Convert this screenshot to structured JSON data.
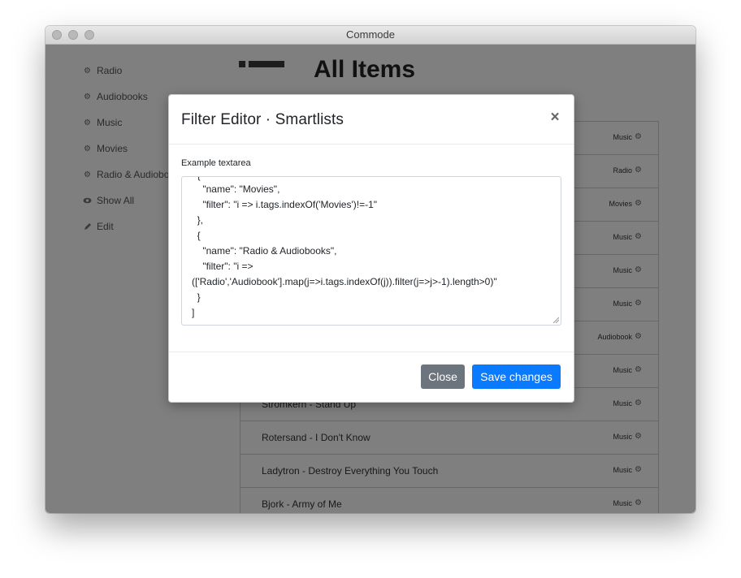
{
  "window": {
    "title": "Commode"
  },
  "sidebar": {
    "items": [
      {
        "label": "Radio",
        "icon": "gear-icon"
      },
      {
        "label": "Audiobooks",
        "icon": "gear-icon"
      },
      {
        "label": "Music",
        "icon": "gear-icon"
      },
      {
        "label": "Movies",
        "icon": "gear-icon"
      },
      {
        "label": "Radio & Audiobo",
        "icon": "gear-icon"
      },
      {
        "label": "Show All",
        "icon": "eye-icon"
      },
      {
        "label": "Edit",
        "icon": "pencil-icon"
      }
    ]
  },
  "main": {
    "title": "All Items",
    "rows": [
      {
        "title": "",
        "tag": "Music"
      },
      {
        "title": "",
        "tag": "Radio"
      },
      {
        "title": "",
        "tag": "Movies"
      },
      {
        "title": "",
        "tag": "Music"
      },
      {
        "title": "",
        "tag": "Music"
      },
      {
        "title": "",
        "tag": "Music"
      },
      {
        "title": "",
        "tag": "Audiobook"
      },
      {
        "title": "",
        "tag": "Music"
      },
      {
        "title": "Stromkern - Stand Up",
        "tag": "Music"
      },
      {
        "title": "Rotersand - I Don't Know",
        "tag": "Music"
      },
      {
        "title": "Ladytron - Destroy Everything You Touch",
        "tag": "Music"
      },
      {
        "title": "Bjork - Army of Me",
        "tag": "Music"
      }
    ]
  },
  "modal": {
    "title": "Filter Editor · Smartlists",
    "close_symbol": "×",
    "field_label": "Example textarea",
    "textarea_lines": [
      "  {",
      "    \"name\": \"Movies\",",
      "    \"filter\": \"i => i.tags.indexOf('Movies')!=-1\"",
      "  },",
      "  {",
      "    \"name\": \"Radio & Audiobooks\",",
      "    \"filter\": \"i =>",
      "(['Radio','Audiobook'].map(j=>i.tags.indexOf(j)).filter(j=>j>-1).length>0)\"",
      "  }",
      "]"
    ],
    "close_label": "Close",
    "save_label": "Save changes"
  },
  "colors": {
    "primary": "#0a7bff",
    "secondary": "#6c757d",
    "overlay": "rgba(0,0,0,0.5)"
  }
}
